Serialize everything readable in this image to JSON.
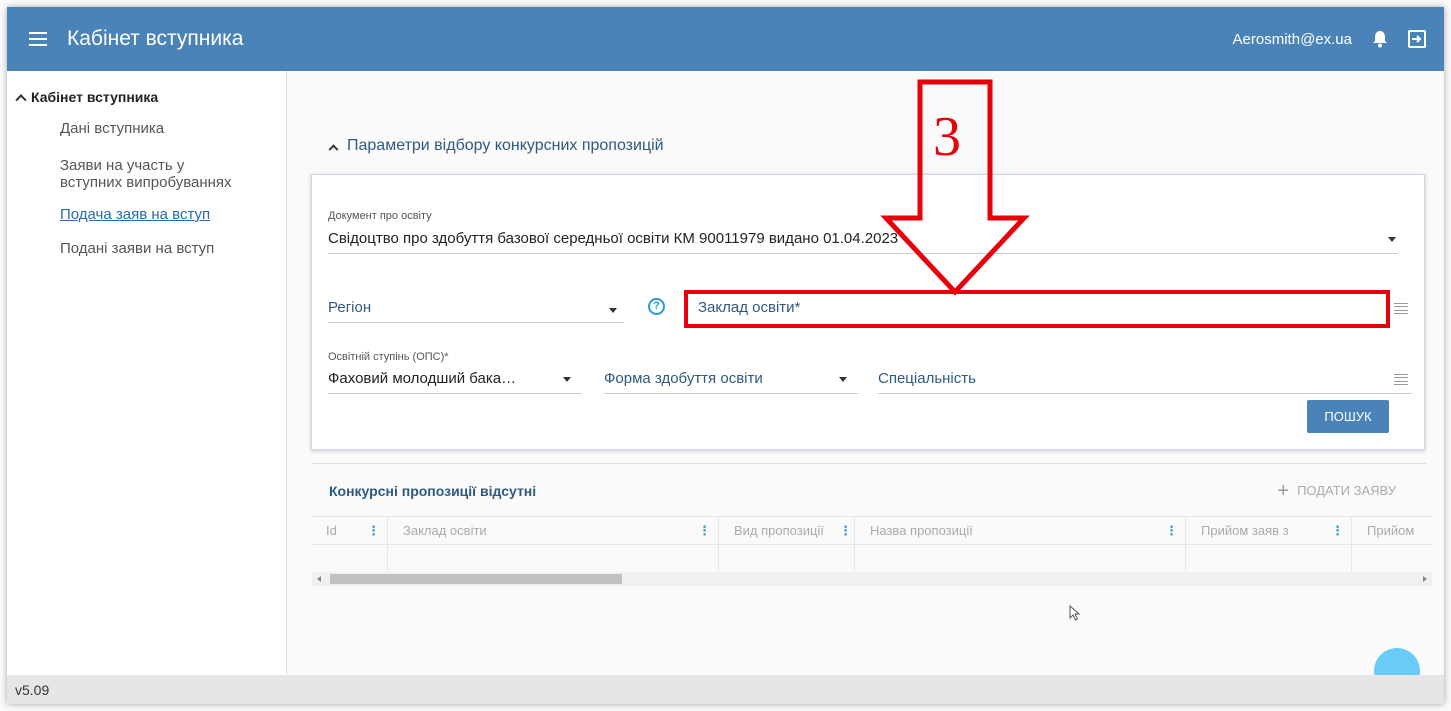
{
  "header": {
    "title": "Кабінет вступника",
    "user_email": "Aerosmith@ex.ua",
    "color": "#4a83b8"
  },
  "sidebar": {
    "heading": "Кабінет вступника",
    "items": [
      {
        "label": "Дані вступника"
      },
      {
        "label_line1": "Заяви на участь у",
        "label_line2": "вступних випробуваннях"
      },
      {
        "label": "Подача заяв на вступ",
        "active": true
      },
      {
        "label": "Подані заяви на вступ"
      }
    ]
  },
  "main": {
    "section_title": "Параметри відбору конкурсних пропозицій",
    "filters": {
      "document_label": "Документ про освіту",
      "document_value": "Свідоцтво про здобуття базової середньої освіти КМ 90011979 видано 01.04.2023",
      "region_placeholder": "Регіон",
      "institution_placeholder": "Заклад освіти*",
      "degree_label": "Освітній ступінь (ОПС)*",
      "degree_value": "Фаховий молодший бака…",
      "study_form_placeholder": "Форма здобуття освіти",
      "specialty_placeholder": "Спеціальність",
      "search_button": "ПОШУК"
    },
    "results": {
      "title": "Конкурсні пропозиції відсутні",
      "submit_button": "ПОДАТИ ЗАЯВУ",
      "columns": [
        "Id",
        "Заклад освіти",
        "Вид пропозиції",
        "Назва пропозиції",
        "Прийом заяв з",
        "Прийом"
      ]
    }
  },
  "annotation": {
    "step_number": "3",
    "color": "#e8000b"
  },
  "footer": {
    "version": "v5.09"
  }
}
